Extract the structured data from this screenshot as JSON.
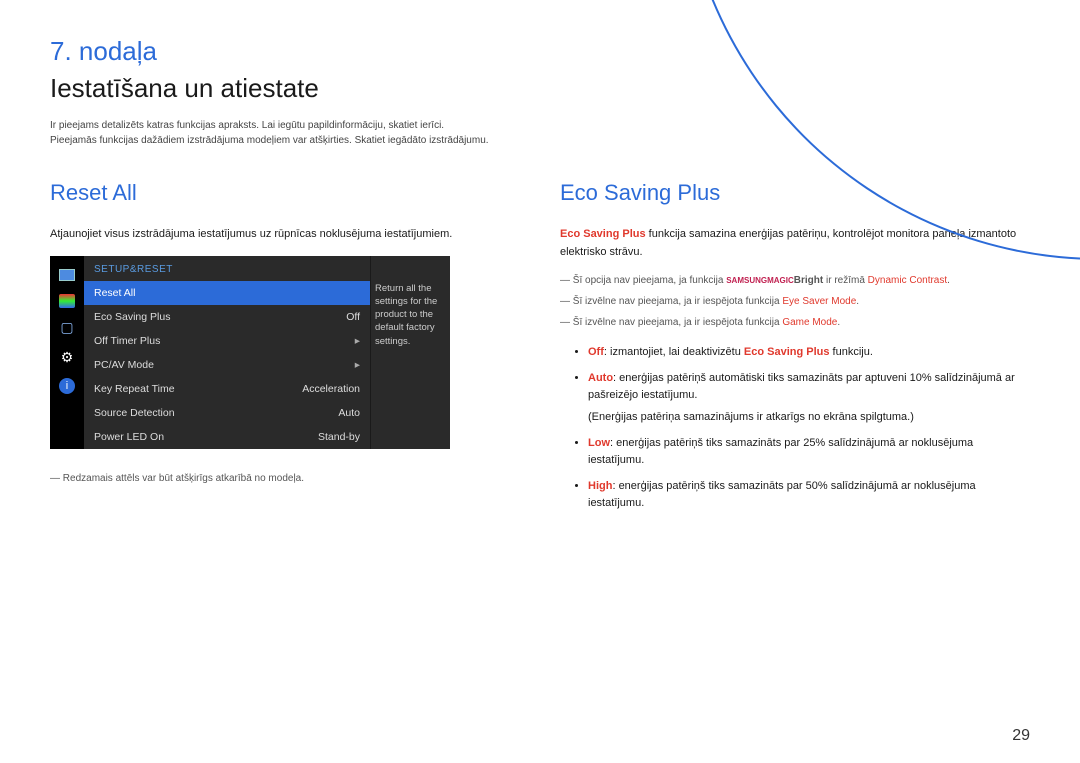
{
  "header": {
    "chapter": "7. nodaļa",
    "title": "Iestatīšana un atiestate",
    "intro1": "Ir pieejams detalizēts katras funkcijas apraksts. Lai iegūtu papildinformāciju, skatiet ierīci.",
    "intro2": "Pieejamās funkcijas dažādiem izstrādājuma modeļiem var atšķirties. Skatiet iegādāto izstrādājumu."
  },
  "left": {
    "heading": "Reset All",
    "desc": "Atjaunojiet visus izstrādājuma iestatījumus uz rūpnīcas noklusējuma iestatījumiem.",
    "osd": {
      "title": "SETUP&RESET",
      "rows": [
        {
          "label": "Reset All",
          "val": ""
        },
        {
          "label": "Eco Saving Plus",
          "val": "Off"
        },
        {
          "label": "Off Timer Plus",
          "val": "▸"
        },
        {
          "label": "PC/AV Mode",
          "val": "▸"
        },
        {
          "label": "Key Repeat Time",
          "val": "Acceleration"
        },
        {
          "label": "Source Detection",
          "val": "Auto"
        },
        {
          "label": "Power LED On",
          "val": "Stand-by"
        }
      ],
      "side": "Return all the settings for the product to the default factory settings."
    },
    "footnote": "Redzamais attēls var būt atšķirīgs atkarībā no modeļa."
  },
  "right": {
    "heading": "Eco Saving Plus",
    "desc_lead_hl": "Eco Saving Plus",
    "desc_rest": " funkcija samazina enerģijas patēriņu, kontrolējot monitora paneļa izmantoto elektrisko strāvu.",
    "fn1_a": "Šī opcija nav pieejama, ja funkcija ",
    "fn1_magic1": "SAMSUNG",
    "fn1_magic2": "MAGIC",
    "fn1_bright": "Bright",
    "fn1_b": " ir režīmā ",
    "fn1_hl": "Dynamic Contrast",
    "fn1_c": ".",
    "fn2_a": "Šī izvēlne nav pieejama, ja ir iespējota funkcija ",
    "fn2_hl": "Eye Saver Mode",
    "fn2_b": ".",
    "fn3_a": "Šī izvēlne nav pieejama, ja ir iespējota funkcija ",
    "fn3_hl": "Game Mode",
    "fn3_b": ".",
    "b1_hl": "Off",
    "b1_a": ": izmantojiet, lai deaktivizētu ",
    "b1_hl2": "Eco Saving Plus",
    "b1_b": " funkciju.",
    "b2_hl": "Auto",
    "b2_a": ": enerģijas patēriņš automātiski tiks samazināts par aptuveni 10% salīdzinājumā ar pašreizējo iestatījumu.",
    "b2_sub": "(Enerģijas patēriņa samazinājums ir atkarīgs no ekrāna spilgtuma.)",
    "b3_hl": "Low",
    "b3_a": ": enerģijas patēriņš tiks samazināts par 25% salīdzinājumā ar noklusējuma iestatījumu.",
    "b4_hl": "High",
    "b4_a": ": enerģijas patēriņš tiks samazināts par 50% salīdzinājumā ar noklusējuma iestatījumu."
  },
  "page_number": "29"
}
